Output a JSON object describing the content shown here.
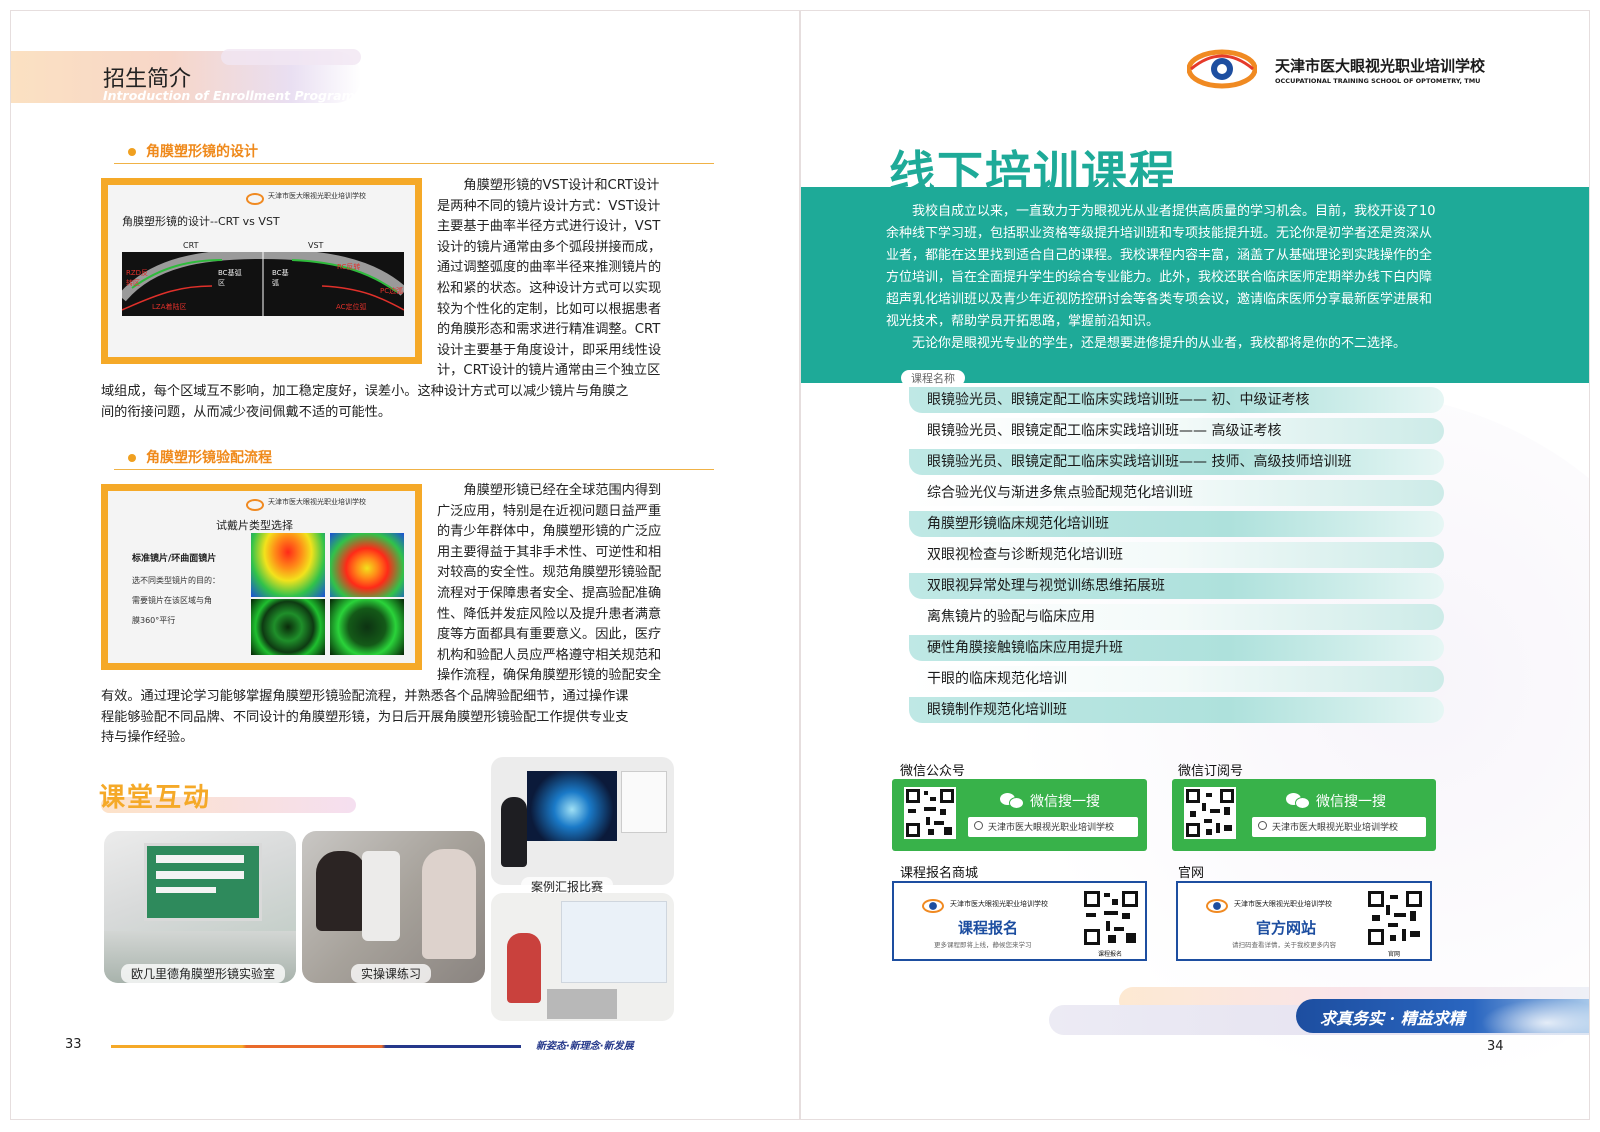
{
  "left": {
    "header": {
      "title": "招生简介",
      "subtitle": "Introduction of Enrollment Program"
    },
    "section1": {
      "title": "角膜塑形镜的设计",
      "paragraph_lines": [
        "角膜塑形镜的VST设计和CRT设计",
        "是两种不同的镜片设计方式：VST设计",
        "主要基于曲率半径方式进行设计，VST",
        "设计的镜片通常由多个弧段拼接而成，",
        "通过调整弧度的曲率半径来推测镜片的",
        "松和紧的状态。这种设计方式可以实现",
        "较为个性化的定制，比如可以根据患者",
        "的角膜形态和需求进行精准调整。CRT",
        "设计主要基于角度设计，即采用线性设",
        "计，CRT设计的镜片通常由三个独立区"
      ],
      "paragraph_tail_lines": [
        "域组成，每个区域互不影响，加工稳定度好，误差小。这种设计方式可以减少镜片与角膜之",
        "间的衔接问题，从而减少夜间佩戴不适的可能性。"
      ],
      "image": {
        "school_name": "天津市医大眼视光职业培训学校",
        "title": "角膜塑形镜的设计--CRT vs VST",
        "crt_label": "CRT",
        "vst_label": "VST",
        "zone_labels": [
          "RZD反转区",
          "LZA着陆区",
          "BC基弧区",
          "BC基弧",
          "RC反转",
          "PC边弧",
          "AC定位弧"
        ]
      }
    },
    "section2": {
      "title": "角膜塑形镜验配流程",
      "paragraph_lines": [
        "角膜塑形镜已经在全球范围内得到",
        "广泛应用，特别是在近视问题日益严重",
        "的青少年群体中，角膜塑形镜的广泛应",
        "用主要得益于其非手术性、可逆性和相",
        "对较高的安全性。规范角膜塑形镜验配",
        "流程对于保障患者安全、提高验配准确",
        "性、降低并发症风险以及提升患者满意",
        "度等方面都具有重要意义。因此，医疗",
        "机构和验配人员应严格遵守相关规范和",
        "操作流程，确保角膜塑形镜的验配安全"
      ],
      "paragraph_tail_lines": [
        "有效。通过理论学习能够掌握角膜塑形镜验配流程，并熟悉各个品牌验配细节，通过操作课",
        "程能够验配不同品牌、不同设计的角膜塑形镜，为日后开展角膜塑形镜验配工作提供专业支",
        "持与操作经验。"
      ],
      "image": {
        "school_name": "天津市医大眼视光职业培训学校",
        "title": "试戴片类型选择",
        "subtitle": "标准镜片/环曲面镜片",
        "lines": [
          "选不同类型镜片的目的：",
          "需要镜片在该区域与角",
          "膜360°平行"
        ]
      }
    },
    "interaction": {
      "title": "课堂互动",
      "captions": [
        "欧几里德角膜塑形镜实验室",
        "实操课练习",
        "案例汇报比赛"
      ]
    },
    "footer": {
      "page_number": "33",
      "slogan": "新姿态·新理念·新发展"
    }
  },
  "right": {
    "logo": {
      "name_cn": "天津市医大眼视光职业培训学校",
      "name_en": "OCCUPATIONAL TRAINING SCHOOL OF OPTOMETRY, TMU"
    },
    "title": "线下培训课程",
    "intro_lines": [
      "我校自成立以来，一直致力于为眼视光从业者提供高质量的学习机会。目前，我校开设了10",
      "余种线下学习班，包括职业资格等级提升培训班和专项技能提升班。无论你是初学者还是资深从",
      "业者，都能在这里找到适合自己的课程。我校课程内容丰富，涵盖了从基础理论到实践操作的全",
      "方位培训，旨在全面提升学生的综合专业能力。此外，我校还联合临床医师定期举办线下白内障",
      "超声乳化培训班以及青少年近视防控研讨会等各类专项会议，邀请临床医师分享最新医学进展和",
      "视光技术，帮助学员开拓思路，掌握前沿知识。",
      "无论你是眼视光专业的学生，还是想要进修提升的从业者，我校都将是你的不二选择。"
    ],
    "course_header": "课程名称",
    "courses": [
      "眼镜验光员、眼镜定配工临床实践培训班—— 初、中级证考核",
      "眼镜验光员、眼镜定配工临床实践培训班—— 高级证考核",
      "眼镜验光员、眼镜定配工临床实践培训班—— 技师、高级技师培训班",
      "综合验光仪与渐进多焦点验配规范化培训班",
      "角膜塑形镜临床规范化培训班",
      "双眼视检查与诊断规范化培训班",
      "双眼视异常处理与视觉训练思维拓展班",
      "离焦镜片的验配与临床应用",
      "硬性角膜接触镜临床应用提升班",
      "干眼的临床规范化培训",
      "眼镜制作规范化培训班"
    ],
    "wechat_public": {
      "label": "微信公众号",
      "search_text": "微信搜一搜",
      "search_value": "天津市医大眼视光职业培训学校"
    },
    "wechat_sub": {
      "label": "微信订阅号",
      "search_text": "微信搜一搜",
      "search_value": "天津市医大眼视光职业培训学校"
    },
    "mall": {
      "label": "课程报名商城",
      "school": "天津市医大眼视光职业培训学校",
      "action": "课程报名",
      "desc": "更多课程即将上线，静候您来学习",
      "qr_caption": "课程报名"
    },
    "website": {
      "label": "官网",
      "school": "天津市医大眼视光职业培训学校",
      "action": "官方网站",
      "desc": "请扫码查看详情，关于我校更多内容",
      "qr_caption": "官网"
    },
    "motto": "求真务实 · 精益求精",
    "page_number": "34"
  },
  "colors": {
    "teal": "#1eaa98",
    "orange": "#f5a928",
    "heading_orange": "#ef8a1c",
    "wechat_green": "#38b24a",
    "qr_blue": "#1d4ea0"
  }
}
